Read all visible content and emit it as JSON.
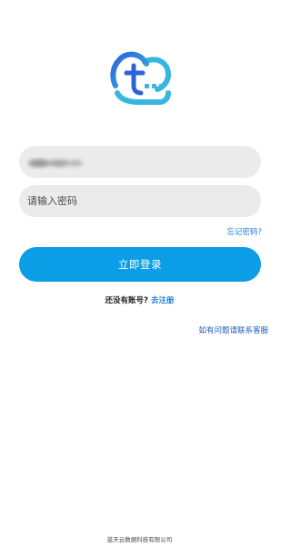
{
  "login_form": {
    "password_placeholder": "请输入密码",
    "forgot_password": "忘记密码?",
    "login_button": "立即登录",
    "register_prompt": "还没有账号?",
    "register_link": "去注册"
  },
  "help_link": "如有问题请联系客服",
  "footer_company": "蓝天云数据科技有限公司",
  "colors": {
    "primary_button": "#0b9ee6",
    "link": "#1c7fd6",
    "field_bg": "#ebebeb",
    "logo_blue": "#2b62d9",
    "logo_cyan": "#38b6e0"
  },
  "icons": {
    "logo": "cloud-logo-icon"
  }
}
